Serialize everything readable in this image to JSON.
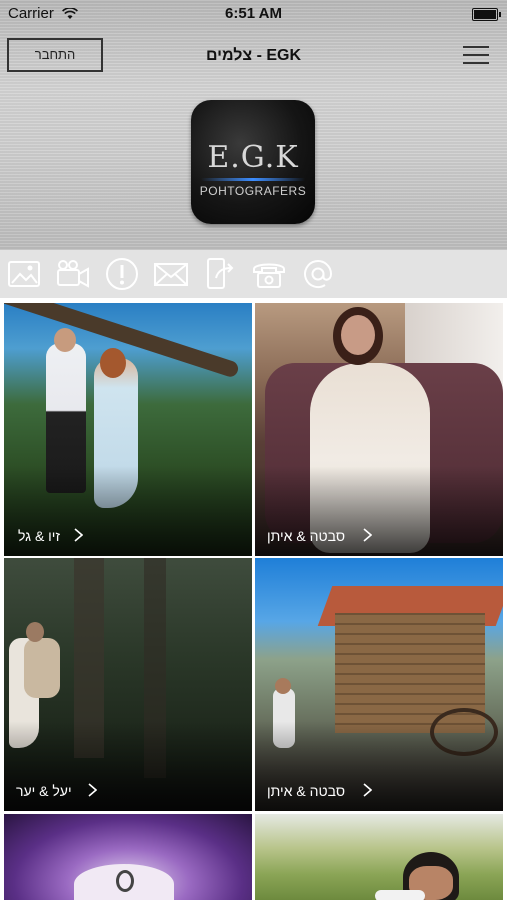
{
  "status_bar": {
    "carrier": "Carrier",
    "time": "6:51 AM"
  },
  "header": {
    "login_label": "התחבר",
    "title": "צלמים - EGK",
    "logo_main": "E.G.K",
    "logo_sub": "POHTOGRAFERS"
  },
  "icons": [
    "gallery-icon",
    "video-camera-icon",
    "info-icon",
    "mail-icon",
    "share-icon",
    "phone-icon",
    "at-sign-icon"
  ],
  "albums": [
    {
      "caption": "זיו & גל"
    },
    {
      "caption": "סבטה & איתן"
    },
    {
      "caption": "יעל & יער"
    },
    {
      "caption": "סבטה & איתן"
    },
    {
      "caption": ""
    },
    {
      "caption": ""
    }
  ]
}
